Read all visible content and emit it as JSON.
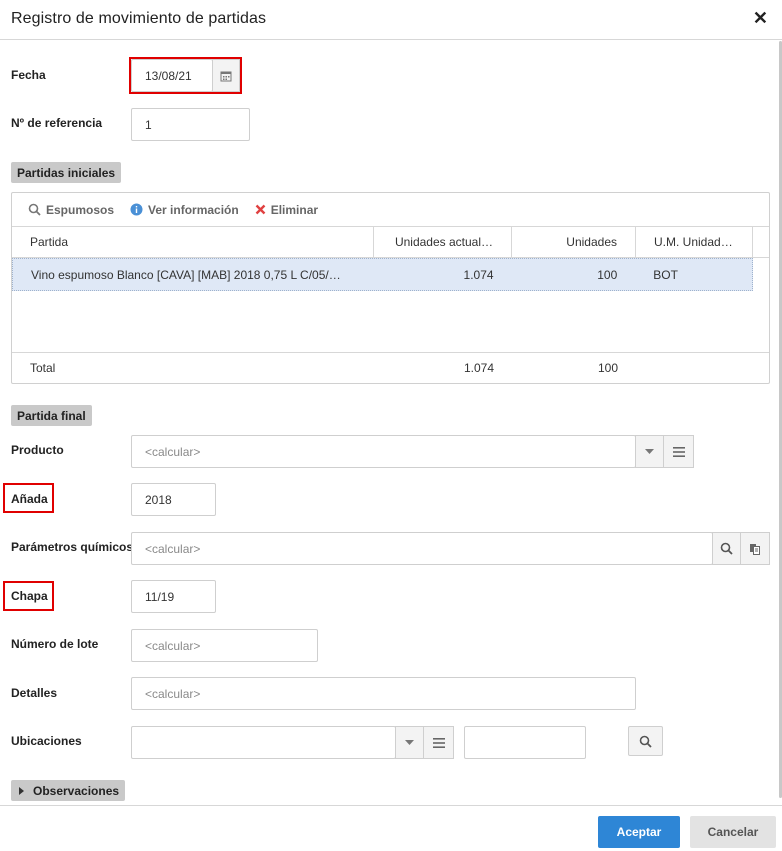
{
  "dialog": {
    "title": "Registro de movimiento de partidas",
    "close_glyph": "✕"
  },
  "form": {
    "fecha": {
      "label": "Fecha",
      "value": "13/08/21"
    },
    "referencia": {
      "label": "Nº de referencia",
      "value": "1"
    }
  },
  "partidas_iniciales": {
    "section_label": "Partidas iniciales",
    "toolbar": {
      "espumosos": "Espumosos",
      "ver_informacion": "Ver información",
      "eliminar": "Eliminar"
    },
    "columns": [
      "Partida",
      "Unidades actual…",
      "Unidades",
      "U.M. Unidad…"
    ],
    "rows": [
      {
        "partida": "Vino espumoso Blanco [CAVA] [MAB] 2018 0,75 L C/05/…",
        "unidades_actual": "1.074",
        "unidades": "100",
        "um": "BOT"
      }
    ],
    "total": {
      "label": "Total",
      "unidades_actual": "1.074",
      "unidades": "100"
    }
  },
  "partida_final": {
    "section_label": "Partida final",
    "producto": {
      "label": "Producto",
      "placeholder": "<calcular>"
    },
    "anada": {
      "label": "Añada",
      "value": "2018"
    },
    "parametros": {
      "label": "Parámetros químicos",
      "placeholder": "<calcular>"
    },
    "chapa": {
      "label": "Chapa",
      "value": "11/19"
    },
    "lote": {
      "label": "Número de lote",
      "placeholder": "<calcular>"
    },
    "detalles": {
      "label": "Detalles",
      "placeholder": "<calcular>"
    },
    "ubicaciones": {
      "label": "Ubicaciones",
      "value": "",
      "extra_value": ""
    }
  },
  "observaciones": {
    "label": "Observaciones"
  },
  "buttons": {
    "accept": "Aceptar",
    "cancel": "Cancelar"
  },
  "colors": {
    "primary": "#2e86d6",
    "highlight": "#e00000",
    "selected_row": "#dfe8f6"
  }
}
